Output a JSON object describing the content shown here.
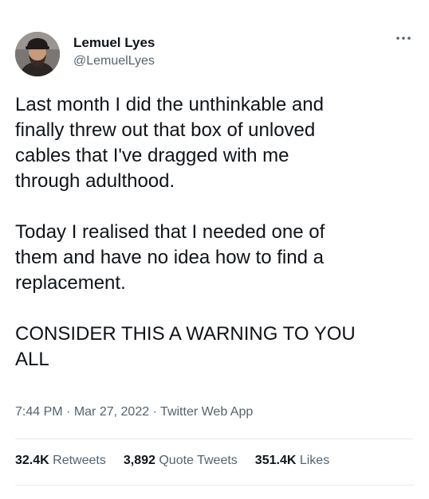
{
  "author": {
    "name": "Lemuel Lyes",
    "handle": "@LemuelLyes",
    "avatar_icon": "profile-photo"
  },
  "menu": {
    "icon": "more-horizontal-icon"
  },
  "tweet": {
    "paragraphs": [
      "Last month I did the unthinkable and\nfinally threw out that box of unloved\ncables that I've dragged with me\nthrough adulthood.",
      "Today I realised that I needed one of\nthem and have no idea how to find a\nreplacement.",
      "CONSIDER THIS A WARNING TO YOU\nALL"
    ],
    "time": "7:44 PM",
    "separator": "·",
    "date": "Mar 27, 2022",
    "source": "Twitter Web App"
  },
  "stats": {
    "retweets_count": "32.4K",
    "retweets_label": "Retweets",
    "quotes_count": "3,892",
    "quotes_label": "Quote Tweets",
    "likes_count": "351.4K",
    "likes_label": "Likes"
  },
  "colors": {
    "text": "#0f1419",
    "secondary": "#536471",
    "divider": "#e6ecf0"
  }
}
